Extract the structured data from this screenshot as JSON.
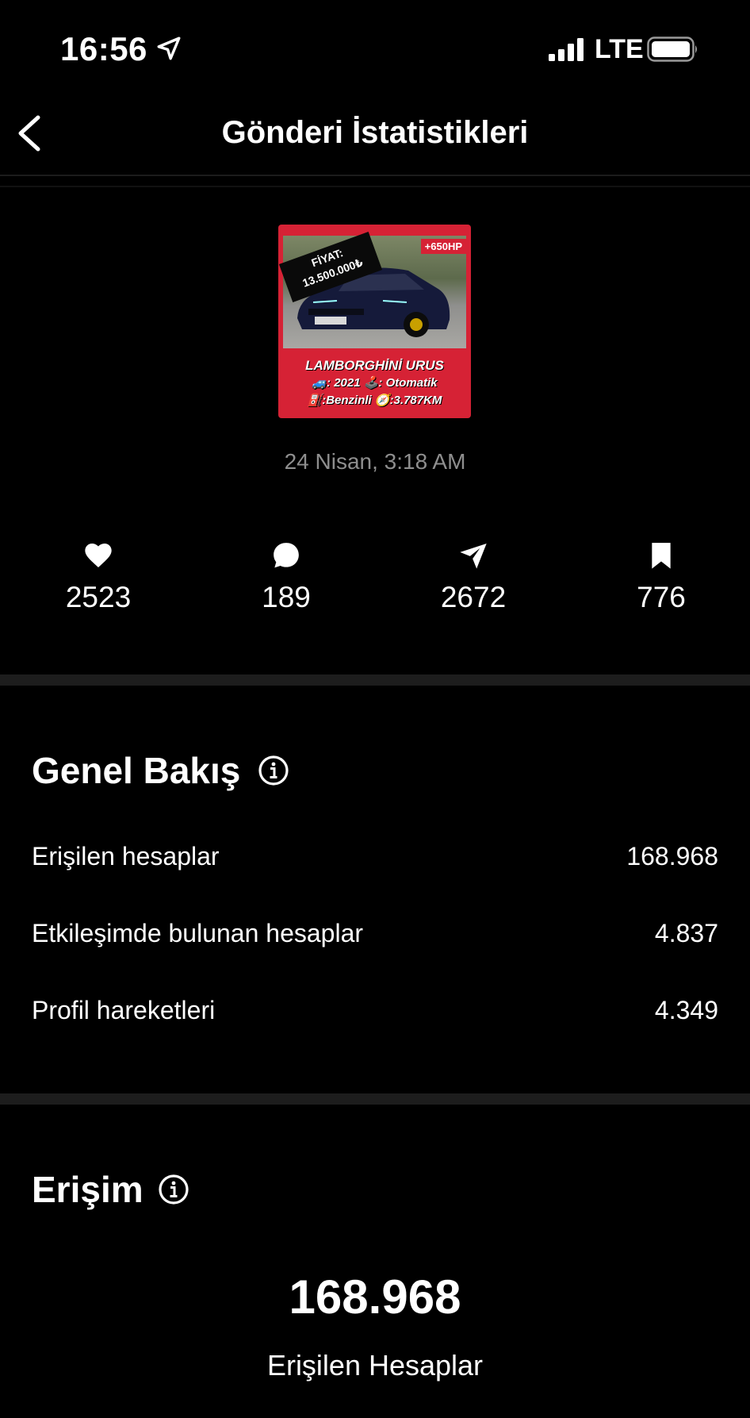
{
  "status_bar": {
    "time": "16:56",
    "network": "LTE"
  },
  "header": {
    "title": "Gönderi İstatistikleri"
  },
  "post": {
    "thumbnail_text": {
      "price_label": "FİYAT:",
      "price": "13.500.000₺",
      "hp": "+650HP",
      "line1": "LAMBORGHİNİ URUS",
      "line2": "🚙: 2021 🕹️: Otomatik",
      "line3": "⛽:Benzinli 🧭:3.787KM"
    },
    "date": "24 Nisan, 3:18 AM"
  },
  "metrics": [
    {
      "icon": "heart-icon",
      "value": "2523"
    },
    {
      "icon": "comment-icon",
      "value": "189"
    },
    {
      "icon": "share-icon",
      "value": "2672"
    },
    {
      "icon": "bookmark-icon",
      "value": "776"
    }
  ],
  "overview": {
    "title": "Genel Bakış",
    "rows": [
      {
        "label": "Erişilen hesaplar",
        "value": "168.968"
      },
      {
        "label": "Etkileşimde bulunan hesaplar",
        "value": "4.837"
      },
      {
        "label": "Profil hareketleri",
        "value": "4.349"
      }
    ]
  },
  "reach": {
    "title": "Erişim",
    "value": "168.968",
    "label": "Erişilen Hesaplar"
  },
  "colors": {
    "background": "#000000",
    "text": "#ffffff",
    "muted": "#8e8e8e",
    "thumbnail_red": "#d62235",
    "divider": "#1d1d1d"
  }
}
